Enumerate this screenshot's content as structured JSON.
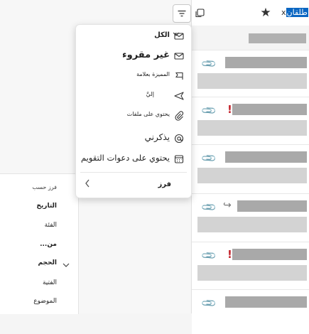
{
  "header": {
    "sender_label": "x",
    "sender_highlight": "طلقان"
  },
  "filter_menu": {
    "items": [
      {
        "label": "الكل",
        "icon": "envelope-icon",
        "selected": true
      },
      {
        "label": "غير مقروء",
        "icon": "envelope-icon"
      },
      {
        "label": "المميزة بعلامة",
        "icon": "flag-icon"
      },
      {
        "label": "إليَّ",
        "icon": "send-icon"
      },
      {
        "label": "يحتوي على ملفات",
        "icon": "paperclip-icon"
      },
      {
        "label": "يذكرني",
        "icon": "mention-icon"
      },
      {
        "label": "يحتوي على دعوات التقويم",
        "icon": "calendar-icon"
      }
    ],
    "sort_label": "فرز"
  },
  "sort_pane": {
    "title": "فرز حسب",
    "options": [
      "التاريخ",
      "الفئة",
      "من",
      "الحجم",
      "الفتية",
      "الموضوع"
    ],
    "from_suffix": "..."
  },
  "colors": {
    "flag_red": "#c4262e",
    "highlight_blue": "#0a66c2"
  }
}
